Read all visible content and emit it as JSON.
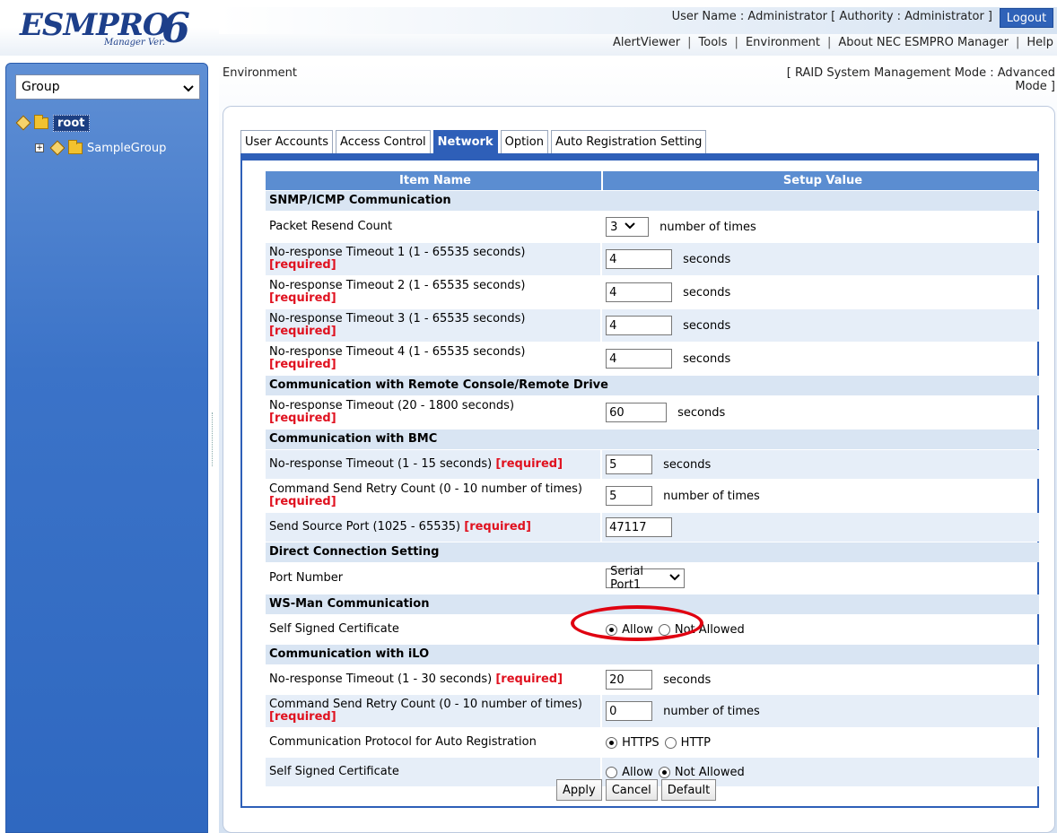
{
  "header": {
    "logo_main": "ESMPRO",
    "logo_sub": "Manager Ver.",
    "logo_version": "6",
    "user_line": "User Name : Administrator [ Authority : Administrator ]",
    "logout_label": "Logout",
    "nav": [
      "AlertViewer",
      "Tools",
      "Environment",
      "About NEC ESMPRO Manager",
      "Help"
    ]
  },
  "sidebar": {
    "select_value": "Group",
    "tree": {
      "root": "root",
      "child": "SampleGroup"
    }
  },
  "page": {
    "title": "Environment",
    "mode_line1": "[ RAID System Management Mode : Advanced",
    "mode_line2": "Mode ]"
  },
  "tabs": [
    "User Accounts",
    "Access Control",
    "Network",
    "Option",
    "Auto Registration Setting"
  ],
  "active_tab": "Network",
  "table": {
    "col_item": "Item Name",
    "col_value": "Setup Value",
    "snmp_section": "SNMP/ICMP Communication",
    "packet_resend_label": "Packet Resend Count",
    "packet_resend_value": "3",
    "times_unit": "number of times",
    "seconds_unit": "seconds",
    "required": "[required]",
    "timeout1_label": "No-response Timeout 1  (1 - 65535 seconds)",
    "timeout1_value": "4",
    "timeout2_label": "No-response Timeout 2  (1 - 65535 seconds)",
    "timeout2_value": "4",
    "timeout3_label": "No-response Timeout 3  (1 - 65535 seconds)",
    "timeout3_value": "4",
    "timeout4_label": "No-response Timeout 4  (1 - 65535 seconds)",
    "timeout4_value": "4",
    "remote_section": "Communication with Remote Console/Remote Drive",
    "remote_timeout_label": "No-response Timeout  (20 - 1800 seconds)",
    "remote_timeout_value": "60",
    "bmc_section": "Communication with BMC",
    "bmc_timeout_label": "No-response Timeout  (1 - 15 seconds)",
    "bmc_timeout_value": "5",
    "bmc_retry_label": "Command Send Retry Count  (0 - 10 number of times)",
    "bmc_retry_value": "5",
    "bmc_port_label": "Send Source Port  (1025 - 65535)",
    "bmc_port_value": "47117",
    "direct_section": "Direct Connection Setting",
    "port_number_label": "Port Number",
    "port_number_value": "Serial Port1",
    "wsman_section": "WS-Man Communication",
    "wsman_cert_label": "Self Signed Certificate",
    "allow": "Allow",
    "not_allowed": "Not Allowed",
    "ilo_section": "Communication with iLO",
    "ilo_timeout_label": "No-response Timeout  (1 - 30 seconds)",
    "ilo_timeout_value": "20",
    "ilo_retry_label": "Command Send Retry Count  (0 - 10 number of times)",
    "ilo_retry_value": "0",
    "protocol_label": "Communication Protocol for Auto Registration",
    "https": "HTTPS",
    "http": "HTTP",
    "ilo_cert_label": "Self Signed Certificate"
  },
  "buttons": {
    "apply": "Apply",
    "cancel": "Cancel",
    "default": "Default"
  },
  "colors": {
    "accent": "#2e5fb8",
    "header_row": "#5b8dd1",
    "required": "#e0111f",
    "annotation": "#e00010"
  }
}
